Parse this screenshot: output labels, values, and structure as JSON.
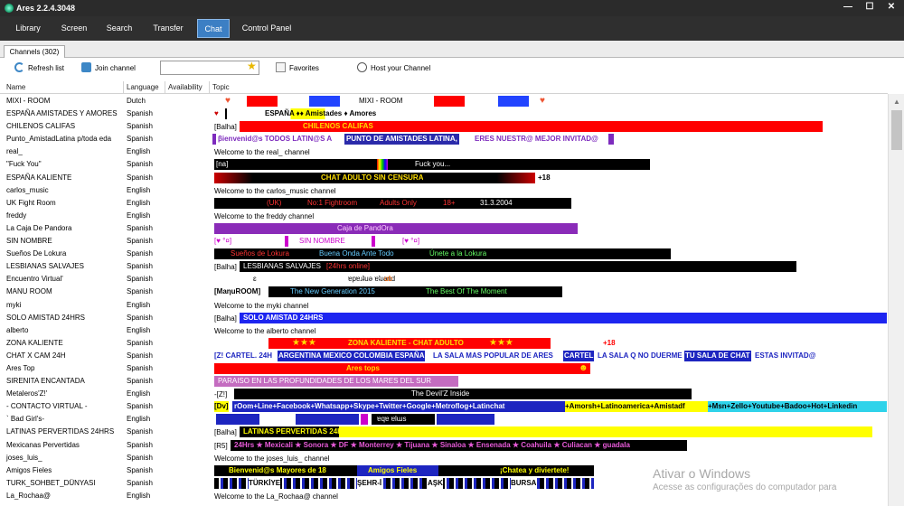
{
  "window": {
    "title": "Ares 2.2.4.3048",
    "minimize": "—",
    "maximize": "☐",
    "close": "✕"
  },
  "menu": [
    {
      "label": "Library"
    },
    {
      "label": "Screen"
    },
    {
      "label": "Search"
    },
    {
      "label": "Transfer"
    },
    {
      "label": "Chat"
    },
    {
      "label": "Control Panel"
    }
  ],
  "tab": {
    "label": "Channels (302)"
  },
  "toolbar": {
    "refresh": "Refresh list",
    "join": "Join channel",
    "search_value": "",
    "favorites": "Favorites",
    "host": "Host your Channel"
  },
  "columns": {
    "name": "Name",
    "language": "Language",
    "availability": "Availability",
    "topic": "Topic"
  },
  "colors": {
    "accent": "#3c7fc4",
    "titlebar": "#2b2b2b",
    "menubar": "#2f2f2f"
  },
  "rows": [
    {
      "name": "MIXI - ROOM",
      "lang": "Dutch",
      "topic": "MIXI - ROOM"
    },
    {
      "name": "ESPAÑA AMISTADES Y AMORES",
      "lang": "Spanish",
      "topic": "ESPAÑA ♦♦ Amistades ♦ Amores"
    },
    {
      "name": "CHILENOS CALIFAS",
      "lang": "Spanish",
      "topic": "[Balha]",
      "topic2": "CHILENOS CALIFAS"
    },
    {
      "name": "Punto_AmistadLatina p/toda eda",
      "lang": "Spanish",
      "topic": "βienvenid@s TODOS LATIN@S A",
      "topic2": "PUNTO DE AMISTADES LATINA,",
      "topic3": "ERES NUESTR@ MEJOR INVITAD@"
    },
    {
      "name": "real_",
      "lang": "English",
      "topic": "Welcome to the real_ channel"
    },
    {
      "name": "\"Fuck You\"",
      "lang": "Spanish",
      "topic": "[na]",
      "topic2": "Fuck you..."
    },
    {
      "name": "ESPAÑA KALIENTE",
      "lang": "Spanish",
      "topic": "CHAT ADULTO SIN CENSURA",
      "topic2": "+18"
    },
    {
      "name": "carlos_music",
      "lang": "English",
      "topic": "Welcome to the carlos_music channel"
    },
    {
      "name": "UK Fight Room",
      "lang": "English",
      "topic": "(UK)",
      "topic2": "No:1 Fightroom",
      "topic3": "Adults Only",
      "topic4": "18+",
      "topic5": "31.3.2004"
    },
    {
      "name": "freddy",
      "lang": "English",
      "topic": "Welcome to the freddy channel"
    },
    {
      "name": "La Caja De Pandora",
      "lang": "Spanish",
      "topic": "Caja de PandOra"
    },
    {
      "name": "SIN NOMBRE",
      "lang": "Spanish",
      "topic": "SIN NOMBRE"
    },
    {
      "name": "Sueños De Lokura",
      "lang": "Spanish",
      "topic": "Sueños de Lokura",
      "topic2": "Buena Onda Ante Todo",
      "topic3": "Únete a la Lokura"
    },
    {
      "name": "LESBIANAS SALVAJES",
      "lang": "Spanish",
      "topic": "[Balha]",
      "topic2": "LESBIANAS SALVAJES",
      "topic3": "[24hrs online]"
    },
    {
      "name": "Encuentro Virtual'",
      "lang": "Spanish",
      "topic": "ɐpɐɹʇuǝ ɐʇɹǝnd"
    },
    {
      "name": "MANU ROOM",
      "lang": "Spanish",
      "topic": "[MaηuROOM]",
      "topic2": "The New Generation 2015",
      "topic3": "The Best Of The Moment"
    },
    {
      "name": "myki",
      "lang": "English",
      "topic": "Welcome to the myki channel"
    },
    {
      "name": "SOLO AMISTAD 24HRS",
      "lang": "Spanish",
      "topic": "[Balha]",
      "topic2": "SOLO AMISTAD 24HRS"
    },
    {
      "name": "alberto",
      "lang": "English",
      "topic": "Welcome to the alberto channel"
    },
    {
      "name": "ZONA KALIENTE",
      "lang": "Spanish",
      "topic": "ZONA KALIENTE - CHAT ADULTO",
      "topic2": "+18"
    },
    {
      "name": "CHAT X CAM 24H",
      "lang": "Spanish",
      "topic": "[Z! CARTEL. 24H",
      "topic2": "ARGENTINA MEXICO COLOMBIA ESPAÑA",
      "topic3": "LA SALA MAS POPULAR DE ARES",
      "topic4": "CARTEL",
      "topic5": "LA SALA Q NO DUERME",
      "topic6": "TU SALA DE CHAT",
      "topic7": "ESTAS INVITAD@"
    },
    {
      "name": "Ares Top",
      "lang": "Spanish",
      "topic": "Ares tops"
    },
    {
      "name": "SIRENITA ENCANTADA",
      "lang": "Spanish",
      "topic": "PARAISO EN LAS PROFUNDIDADES DE LOS MARES DEL SUR"
    },
    {
      "name": "Metaleros'Z!'",
      "lang": "English",
      "topic": "-[Z!]",
      "topic2": "The DeviI'Z Inside"
    },
    {
      "name": "- CONTACTO VIRTUAL -",
      "lang": "Spanish",
      "topic": "[Dv]",
      "topic2": "rOom+Line+Facebook+Whatsapp+Skype+Twitter+Google+Metroflog+Latinchat",
      "topic3": "+Amorsh+Latinoamerica+Amistadf",
      "topic4": "+Msn+Zello+Youtube+Badoo+Hot+Linkedin"
    },
    {
      "name": "` Bad Girl's-",
      "lang": "English",
      "topic": "ɐqɐ ɐlɯs"
    },
    {
      "name": "LATINAS PERVERTIDAS 24HRS",
      "lang": "Spanish",
      "topic": "[Balha]",
      "topic2": "LATINAS PERVERTIDAS 24HRS"
    },
    {
      "name": "Mexicanas Pervertidas",
      "lang": "Spanish",
      "topic": "[R5]",
      "topic2": "24Hrs ★ Mexicali ★ Sonora ★ DF ★ Monterrey ★ Tijuana ★ Sinaloa ★ Ensenada ★ Coahuila ★ Culiacan ★ guadala"
    },
    {
      "name": "joses_luis_",
      "lang": "Spanish",
      "topic": "Welcome to the joses_luis_ channel"
    },
    {
      "name": "Amigos Fieles",
      "lang": "Spanish",
      "topic": "Bienvenid@s  Mayores de 18",
      "topic2": "Amigos  Fieles",
      "topic3": "¡Chatea y diviertete!"
    },
    {
      "name": "TURK_SOHBET_DÜNYASI",
      "lang": "Spanish",
      "topic": "TÜRKİYE",
      "topic2": "ŞEHR-İ",
      "topic3": "AŞK",
      "topic4": "BURSA"
    },
    {
      "name": "La_Rochaa@",
      "lang": "English",
      "topic": "Welcome to the La_Rochaa@ channel"
    }
  ],
  "watermark": {
    "line1": "Ativar o Windows",
    "line2": "Acesse as configurações do computador para"
  }
}
